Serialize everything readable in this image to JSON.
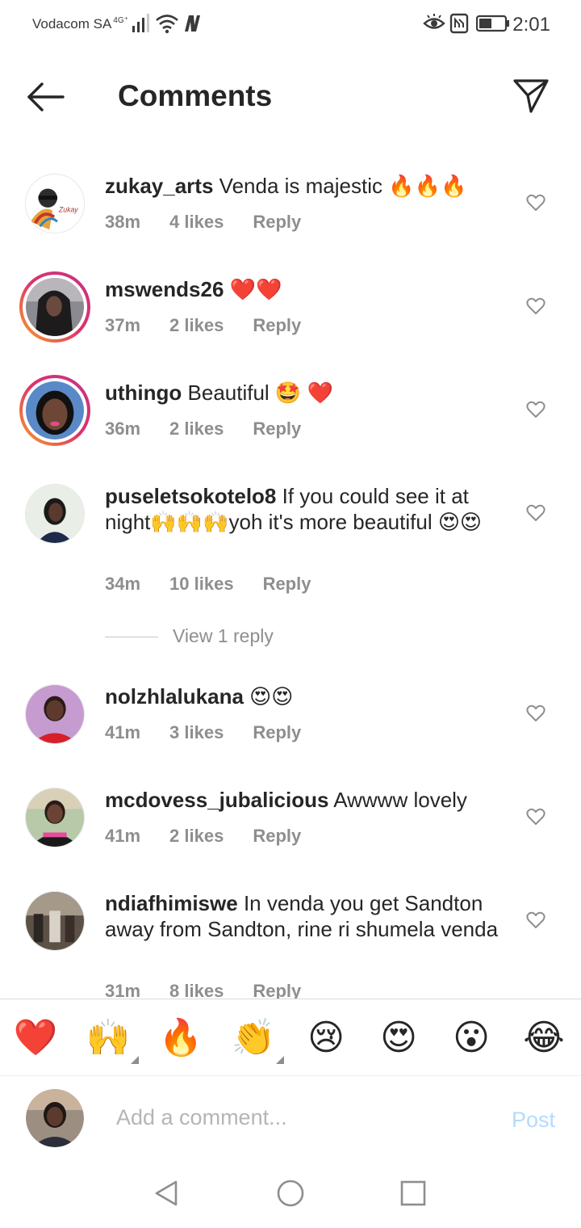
{
  "status_bar": {
    "carrier": "Vodacom SA",
    "network": "4G⁺",
    "time": "2:01"
  },
  "header": {
    "title": "Comments"
  },
  "comments": [
    {
      "user": "zukay_arts",
      "text": "Venda is majestic 🔥🔥🔥",
      "time": "38m",
      "likes": "4 likes",
      "reply": "Reply"
    },
    {
      "user": "mswends26",
      "text": "❤️❤️",
      "time": "37m",
      "likes": "2 likes",
      "reply": "Reply"
    },
    {
      "user": "uthingo",
      "text": "Beautiful 🤩 ❤️",
      "time": "36m",
      "likes": "2 likes",
      "reply": "Reply"
    },
    {
      "user": "puseletsokotelo8",
      "text": "If you could see it at night🙌🙌🙌yoh it's more beautiful 😍😍",
      "time": "34m",
      "likes": "10 likes",
      "reply": "Reply"
    },
    {
      "user": "nolzhlalukana",
      "text": "😍😍",
      "time": "41m",
      "likes": "3 likes",
      "reply": "Reply"
    },
    {
      "user": "mcdovess_jubalicious",
      "text": "Awwww lovely",
      "time": "41m",
      "likes": "2 likes",
      "reply": "Reply"
    },
    {
      "user": "ndiafhimiswe",
      "text": "In venda you get Sandton away from Sandton, rine ri shumela venda",
      "time": "31m",
      "likes": "8 likes",
      "reply": "Reply"
    }
  ],
  "view_replies": "View 1 reply",
  "reactions": [
    "❤️",
    "🙌",
    "🔥",
    "👏",
    "😢",
    "😍",
    "😮",
    "😂"
  ],
  "composer": {
    "placeholder": "Add a comment...",
    "post_label": "Post"
  },
  "colors": {
    "text": "#262626",
    "meta": "#8e8e8e",
    "post_disabled": "#b3dbff",
    "story_ring": "#e1306c"
  }
}
